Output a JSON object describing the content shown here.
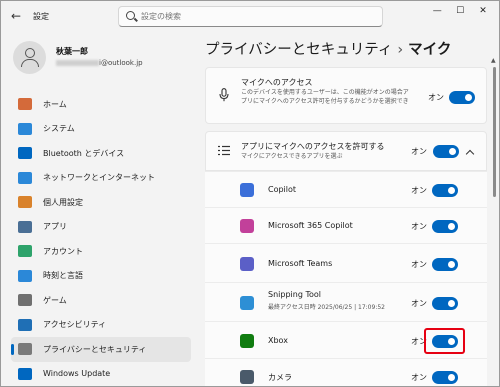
{
  "window": {
    "back_icon": "back-arrow-icon",
    "title": "設定",
    "controls": [
      "—",
      "☐",
      "✕"
    ]
  },
  "search": {
    "placeholder": "設定の検索",
    "icon": "search-icon"
  },
  "profile": {
    "name": "秋葉一郎",
    "email_suffix": "i@outlook.jp"
  },
  "nav": {
    "items": [
      {
        "label": "ホーム",
        "icon": "home-icon",
        "color": "#d46a3a",
        "selected": false
      },
      {
        "label": "システム",
        "icon": "monitor-icon",
        "color": "#2b88d8",
        "selected": false
      },
      {
        "label": "Bluetooth とデバイス",
        "icon": "bluetooth-icon",
        "color": "#0067c0",
        "selected": false
      },
      {
        "label": "ネットワークとインターネット",
        "icon": "wifi-icon",
        "color": "#2b88d8",
        "selected": false
      },
      {
        "label": "個人用設定",
        "icon": "brush-icon",
        "color": "#d9822b",
        "selected": false
      },
      {
        "label": "アプリ",
        "icon": "apps-icon",
        "color": "#4a6f95",
        "selected": false
      },
      {
        "label": "アカウント",
        "icon": "account-icon",
        "color": "#2ea36b",
        "selected": false
      },
      {
        "label": "時刻と言語",
        "icon": "globe-clock-icon",
        "color": "#2b88d8",
        "selected": false
      },
      {
        "label": "ゲーム",
        "icon": "gamepad-icon",
        "color": "#707070",
        "selected": false
      },
      {
        "label": "アクセシビリティ",
        "icon": "accessibility-icon",
        "color": "#1f6fb5",
        "selected": false
      },
      {
        "label": "プライバシーとセキュリティ",
        "icon": "shield-icon",
        "color": "#7a7a7a",
        "selected": true
      },
      {
        "label": "Windows Update",
        "icon": "update-icon",
        "color": "#0067c0",
        "selected": false
      }
    ]
  },
  "breadcrumb": {
    "parent": "プライバシーとセキュリティ",
    "separator": "›",
    "current": "マイク"
  },
  "mic_access": {
    "title": "マイクへのアクセス",
    "description": "このデバイスを使用するユーザーは、この機能がオンの場合アプリにマイクへのアクセス許可を付与するかどうかを選択できます",
    "state": "オン",
    "icon": "microphone-icon"
  },
  "app_access": {
    "title": "アプリにマイクへのアクセスを許可する",
    "description": "マイクにアクセスできるアプリを選ぶ",
    "state": "オン",
    "icon": "list-icon",
    "expand_icon": "chevron-up-icon"
  },
  "apps": [
    {
      "name": "Copilot",
      "sub": "",
      "state": "オン",
      "icon": "copilot-icon",
      "color": "#3b6fd9"
    },
    {
      "name": "Microsoft 365 Copilot",
      "sub": "",
      "state": "オン",
      "icon": "m365-copilot-icon",
      "color": "#c2409a"
    },
    {
      "name": "Microsoft Teams",
      "sub": "",
      "state": "オン",
      "icon": "teams-icon",
      "color": "#5b5fc7"
    },
    {
      "name": "Snipping Tool",
      "sub": "最終アクセス日時 2025/06/25 | 17:09:52",
      "state": "オン",
      "icon": "snipping-tool-icon",
      "color": "#2d8fd5"
    },
    {
      "name": "Xbox",
      "sub": "",
      "state": "オン",
      "icon": "xbox-icon",
      "color": "#107c10"
    },
    {
      "name": "カメラ",
      "sub": "",
      "state": "オン",
      "icon": "camera-icon",
      "color": "#4a5a6a"
    }
  ],
  "accent_color": "#0067c0",
  "highlight_color": "#e60012"
}
